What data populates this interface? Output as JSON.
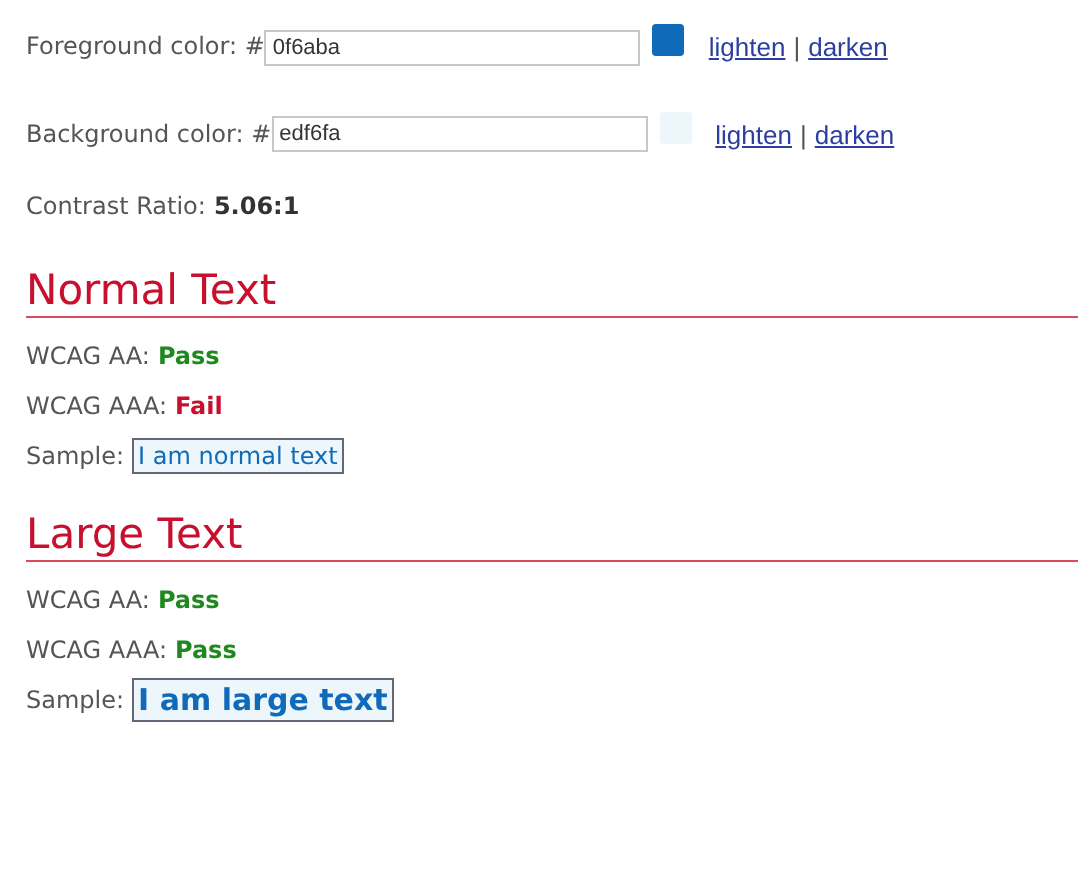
{
  "color_fields": [
    {
      "label": "Foreground color: #",
      "value": "0f6aba",
      "color": "#0f6aba",
      "links": [
        "lighten",
        "|",
        "darken"
      ]
    },
    {
      "label": "Background color: #",
      "value": "edf6fa",
      "color": "#edf6fa",
      "links": [
        "lighten",
        "|",
        "darken"
      ]
    }
  ],
  "contrast": {
    "label": "Contrast Ratio:",
    "value": "5.06:1"
  },
  "sections": [
    {
      "title": "Normal Text",
      "kind": "normal",
      "results": [
        {
          "label": "WCAG AA:",
          "value": "Pass",
          "kind": "pass"
        },
        {
          "label": "WCAG AAA:",
          "value": "Fail",
          "kind": "fail"
        }
      ],
      "sample_label": "Sample:",
      "sample": "I am normal text"
    },
    {
      "title": "Large Text",
      "kind": "large",
      "results": [
        {
          "label": "WCAG AA:",
          "value": "Pass",
          "kind": "pass"
        },
        {
          "label": "WCAG AAA:",
          "value": "Pass",
          "kind": "pass"
        }
      ],
      "sample_label": "Sample:",
      "sample": "I am large text"
    }
  ]
}
